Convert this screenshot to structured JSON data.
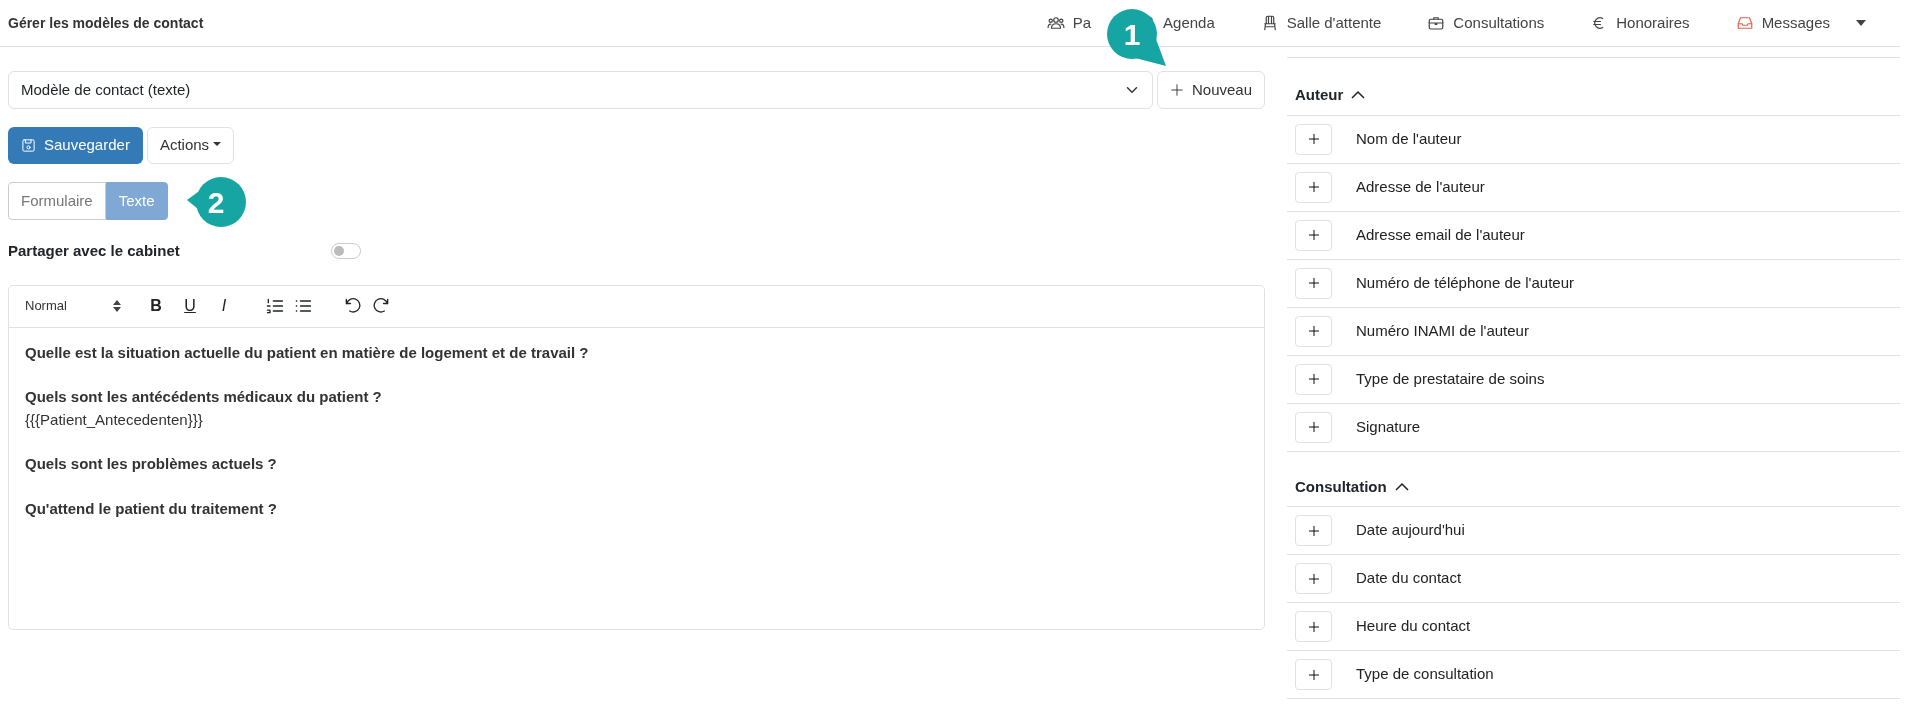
{
  "header": {
    "title": "Gérer les modèles de contact"
  },
  "nav": [
    {
      "label": "Pa",
      "highlighted": false,
      "has_menu": false
    },
    {
      "label": "Agenda",
      "highlighted": false,
      "has_menu": false
    },
    {
      "label": "Salle d'attente",
      "highlighted": false,
      "has_menu": false
    },
    {
      "label": "Consultations",
      "highlighted": false,
      "has_menu": false
    },
    {
      "label": "Honoraires",
      "highlighted": false,
      "has_menu": false
    },
    {
      "label": "Messages",
      "highlighted": true,
      "has_menu": true
    }
  ],
  "template_select": {
    "value": "Modèle de contact (texte)"
  },
  "new_button": "Nouveau",
  "save_button": "Sauvegarder",
  "actions_button": "Actions",
  "view_toggle": [
    {
      "label": "Formulaire",
      "selected": false
    },
    {
      "label": "Texte",
      "selected": true
    }
  ],
  "share": {
    "label": "Partager avec le cabinet",
    "on": false
  },
  "editor": {
    "toolbar": {
      "format": "Normal",
      "marks": [
        "B",
        "U",
        "I"
      ]
    },
    "blocks": [
      {
        "question": "Quelle est la situation actuelle du patient en matière de logement et de travail ?"
      },
      {
        "question": "Quels sont les antécédents médicaux du patient ?",
        "field": "{{{Patient_Antecedenten}}}"
      },
      {
        "question": "Quels sont les problèmes actuels ?"
      },
      {
        "question": "Qu'attend le patient du traitement ?"
      }
    ]
  },
  "sections": [
    {
      "title": "Auteur",
      "expanded": true,
      "items": [
        "Nom de l'auteur",
        "Adresse de l'auteur",
        "Adresse email de l'auteur",
        "Numéro de téléphone de l'auteur",
        "Numéro INAMI de l'auteur",
        "Type de prestataire de soins",
        "Signature"
      ]
    },
    {
      "title": "Consultation",
      "expanded": true,
      "items": [
        "Date aujourd'hui",
        "Date du contact",
        "Heure du contact",
        "Type de consultation"
      ]
    }
  ],
  "callouts": [
    {
      "number": "1"
    },
    {
      "number": "2"
    }
  ]
}
